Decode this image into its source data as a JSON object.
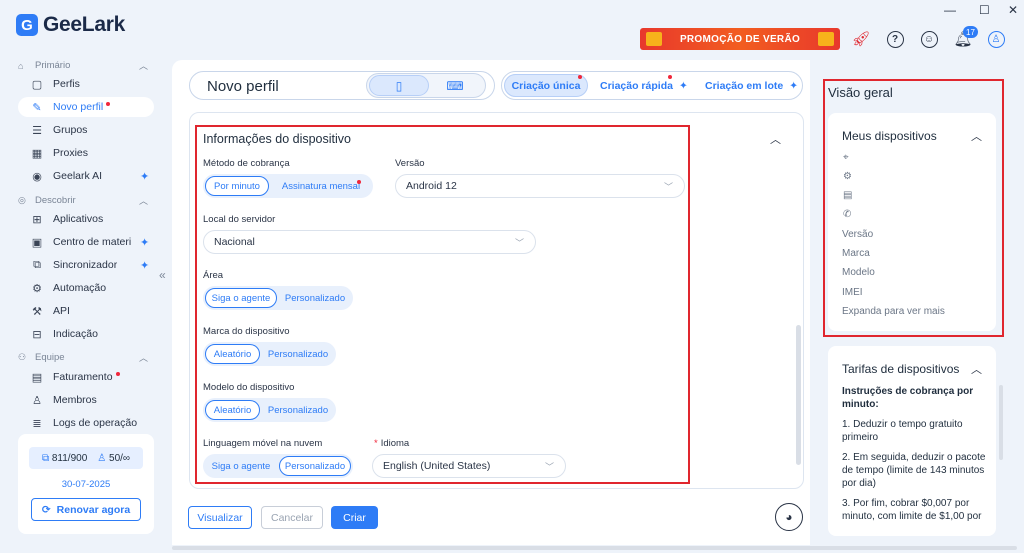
{
  "app": {
    "name": "GeeLark",
    "window_controls": [
      "—",
      "☐",
      "✕"
    ]
  },
  "sidebar": {
    "sections": [
      {
        "label": "Primário",
        "icon": "home-icon",
        "items": [
          {
            "label": "Perfis",
            "icon": "profiles-icon"
          },
          {
            "label": "Novo perfil",
            "icon": "new-profile-icon",
            "active": true,
            "dot": true
          },
          {
            "label": "Grupos",
            "icon": "groups-icon"
          },
          {
            "label": "Proxies",
            "icon": "proxies-icon"
          },
          {
            "label": "Geelark AI",
            "icon": "ai-eye-icon",
            "ai_mark": true
          }
        ]
      },
      {
        "label": "Descobrir",
        "icon": "discover-icon",
        "items": [
          {
            "label": "Aplicativos",
            "icon": "apps-icon"
          },
          {
            "label": "Centro de materi",
            "icon": "material-icon",
            "ai_mark": true
          },
          {
            "label": "Sincronizador",
            "icon": "sync-icon",
            "ai_mark": true
          },
          {
            "label": "Automação",
            "icon": "automation-icon"
          },
          {
            "label": "API",
            "icon": "api-icon"
          },
          {
            "label": "Indicação",
            "icon": "gift-icon"
          }
        ]
      },
      {
        "label": "Equipe",
        "icon": "team-icon",
        "items": [
          {
            "label": "Faturamento",
            "icon": "billing-icon",
            "dot": true
          },
          {
            "label": "Membros",
            "icon": "members-icon"
          },
          {
            "label": "Logs de operação",
            "icon": "logs-icon"
          }
        ]
      }
    ],
    "account": {
      "devices": "811/900",
      "members": "50/∞",
      "date": "30-07-2025",
      "renew_label": "Renovar agora"
    }
  },
  "topbar": {
    "promo_label": "PROMOÇÃO DE VERÃO",
    "notification_count": "17"
  },
  "main": {
    "title": "Novo perfil",
    "modes": [
      "Criação única",
      "Criação rápida",
      "Criação em lote"
    ],
    "section_title": "Informações do dispositivo",
    "billing": {
      "label": "Método de cobrança",
      "options": [
        "Por minuto",
        "Assinatura mensal"
      ]
    },
    "version": {
      "label": "Versão",
      "value": "Android 12"
    },
    "server": {
      "label": "Local do servidor",
      "value": "Nacional"
    },
    "area": {
      "label": "Área",
      "options": [
        "Siga o agente",
        "Personalizado"
      ]
    },
    "brand": {
      "label": "Marca do dispositivo",
      "options": [
        "Aleatório",
        "Personalizado"
      ]
    },
    "model": {
      "label": "Modelo do dispositivo",
      "options": [
        "Aleatório",
        "Personalizado"
      ]
    },
    "mobile_lang": {
      "label": "Linguagem móvel na nuvem",
      "options": [
        "Siga o agente",
        "Personalizado"
      ]
    },
    "language": {
      "label": "Idioma",
      "required": "*",
      "value": "English (United States)"
    },
    "footer": {
      "preview": "Visualizar",
      "cancel": "Cancelar",
      "create": "Criar"
    }
  },
  "overview": {
    "title": "Visão geral",
    "devices_title": "Meus dispositivos",
    "rows": [
      "Versão",
      "Marca",
      "Modelo",
      "IMEI",
      "Expanda para ver mais"
    ],
    "rates_title": "Tarifas de dispositivos",
    "rates_heading": "Instruções de cobrança por minuto:",
    "rates_lines": [
      "1. Deduzir o tempo gratuito primeiro",
      "2. Em seguida, deduzir o pacote de tempo (limite de 143 minutos por dia)",
      "3. Por fim, cobrar $0,007 por minuto, com limite de $1,00 por"
    ]
  }
}
